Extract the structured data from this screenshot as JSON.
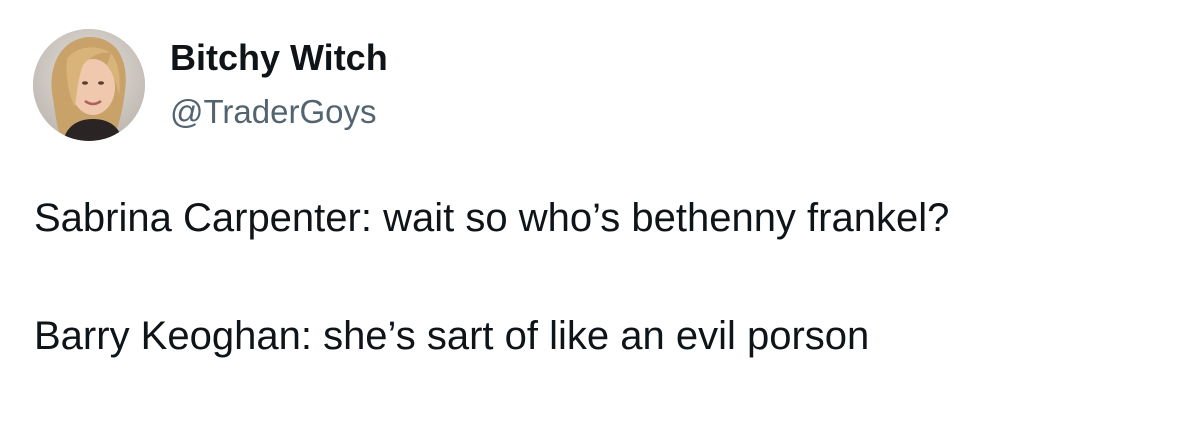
{
  "author": {
    "display_name": "Bitchy Witch",
    "handle": "@TraderGoys",
    "avatar_icon": "profile-photo"
  },
  "tweet": {
    "lines": [
      "Sabrina Carpenter: wait so who’s bethenny frankel?",
      "Barry Keoghan: she’s sart of like an evil porson"
    ]
  },
  "colors": {
    "text_primary": "#0f1419",
    "text_secondary": "#536471",
    "background": "#ffffff"
  }
}
